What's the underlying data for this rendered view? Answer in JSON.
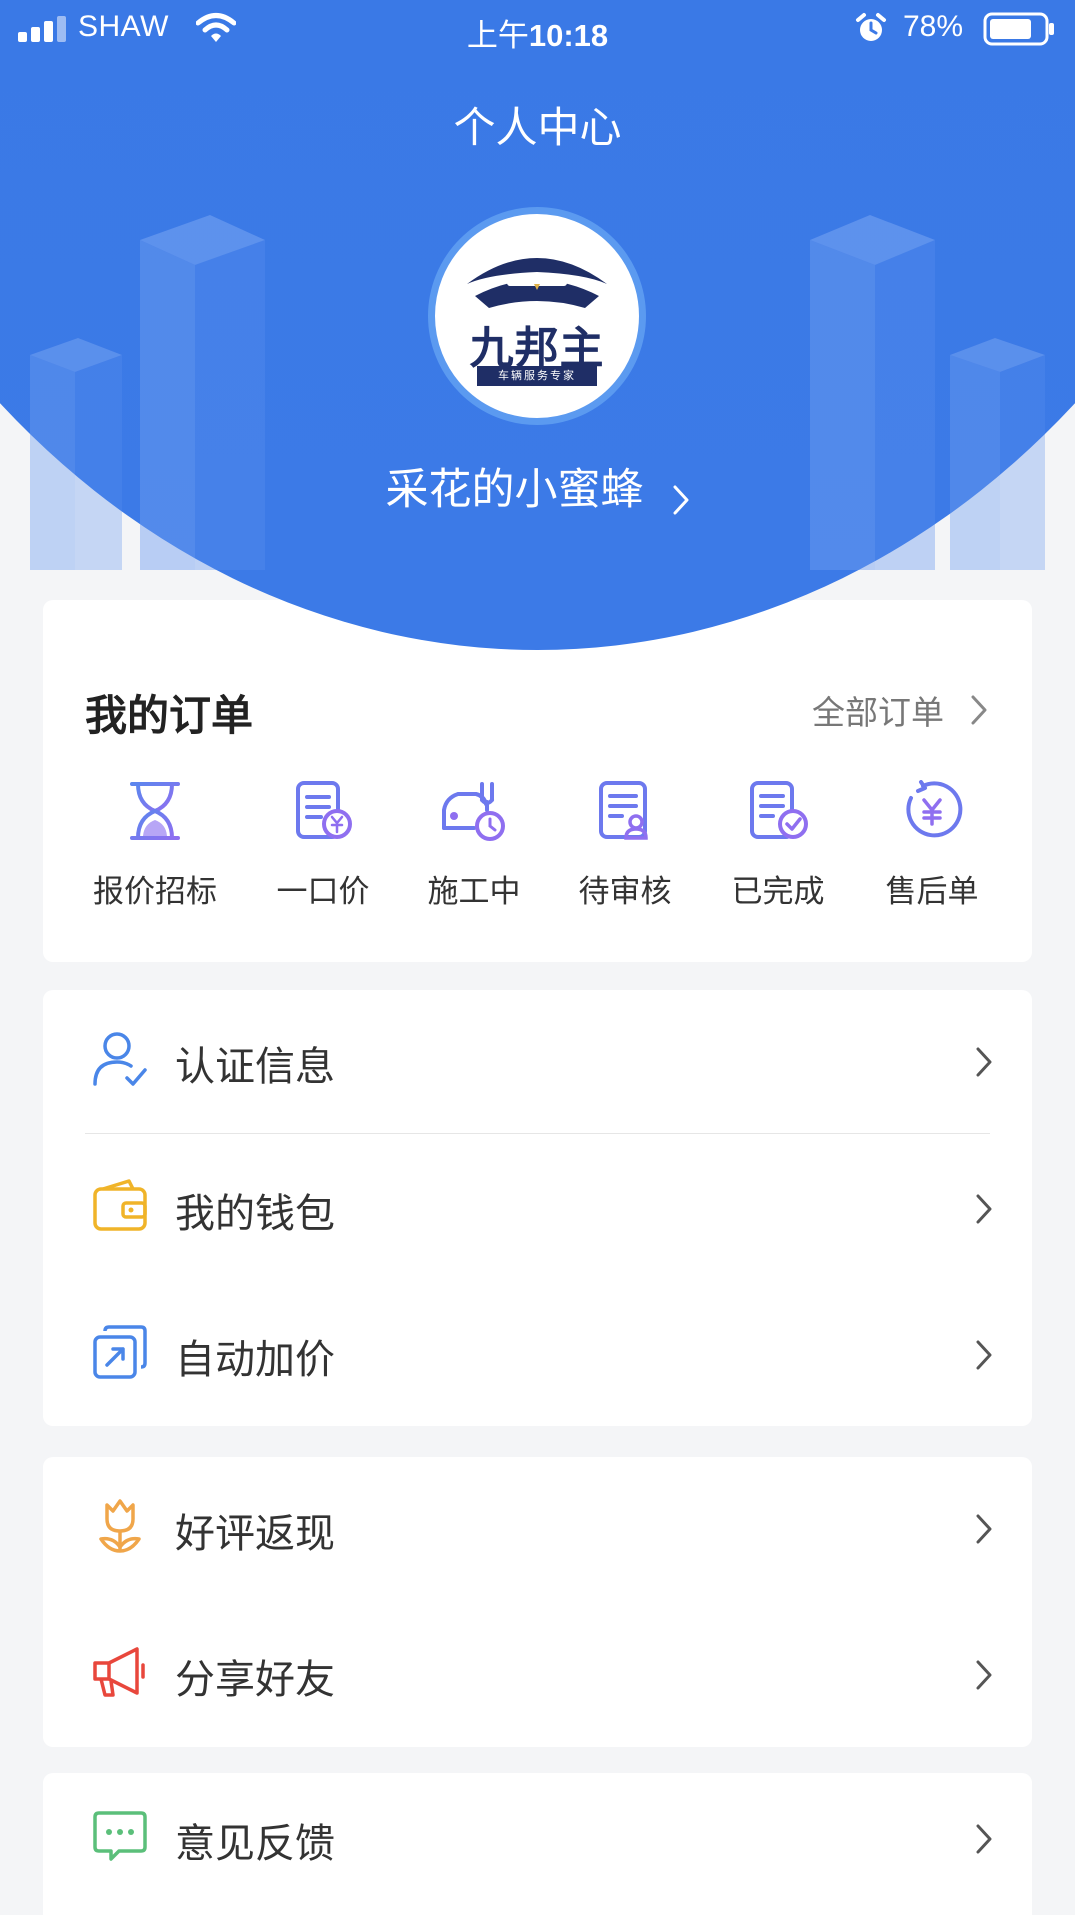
{
  "status_bar": {
    "carrier": "SHAW",
    "time_prefix": "上午",
    "time": "10:18",
    "battery_percent": "78%",
    "battery_level": 0.78
  },
  "header": {
    "title": "个人中心",
    "avatar_logo_text": "九邦主",
    "avatar_logo_subtext": "车辆服务专家",
    "username": "采花的小蜜蜂"
  },
  "orders": {
    "title": "我的订单",
    "all_orders_link": "全部订单",
    "items": [
      {
        "label": "报价招标",
        "icon": "hourglass-icon"
      },
      {
        "label": "一口价",
        "icon": "fixed-price-doc-icon"
      },
      {
        "label": "施工中",
        "icon": "car-repair-icon"
      },
      {
        "label": "待审核",
        "icon": "pending-review-doc-icon"
      },
      {
        "label": "已完成",
        "icon": "completed-doc-icon"
      },
      {
        "label": "售后单",
        "icon": "after-sales-yen-icon"
      }
    ]
  },
  "menu": {
    "group1": [
      {
        "label": "认证信息",
        "icon": "user-verified-icon"
      },
      {
        "label": "我的钱包",
        "icon": "wallet-icon"
      },
      {
        "label": "自动加价",
        "icon": "auto-markup-icon"
      }
    ],
    "group2": [
      {
        "label": "好评返现",
        "icon": "tulip-icon"
      },
      {
        "label": "分享好友",
        "icon": "megaphone-icon"
      }
    ],
    "group3": [
      {
        "label": "意见反馈",
        "icon": "feedback-chat-icon"
      }
    ]
  },
  "colors": {
    "primary": "#3c7ae7",
    "icon_purple": "#7b6ff0",
    "icon_blue": "#4a86e8",
    "wallet_yellow": "#f0b429",
    "tulip_orange": "#f0a64a",
    "megaphone_red": "#e8473c",
    "feedback_green": "#5bbf7a"
  }
}
